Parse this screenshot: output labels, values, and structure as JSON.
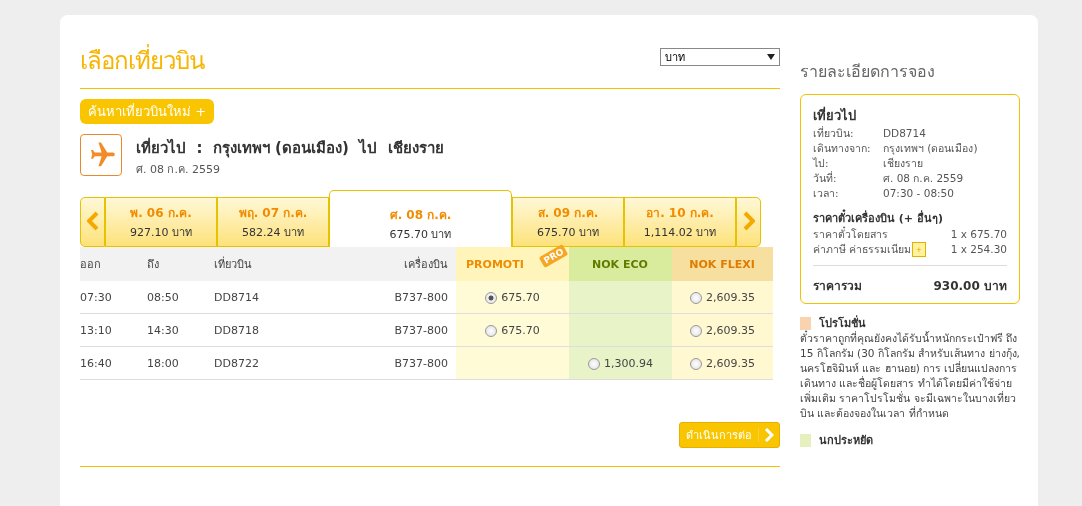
{
  "title": "เลือกเที่ยวบิน",
  "currency": {
    "value": "บาท"
  },
  "new_search": {
    "label": "ค้นหาเที่ยวบินใหม่",
    "icon": "+"
  },
  "route": {
    "title": "เที่ยวไป  :  กรุงเทพฯ (ดอนเมือง)  ไป  เชียงราย",
    "date": "ศ. 08 ก.ค. 2559"
  },
  "date_tabs": [
    {
      "day": "พ. 06 ก.ค.",
      "price": "927.10 บาท",
      "selected": false
    },
    {
      "day": "พฤ. 07 ก.ค.",
      "price": "582.24 บาท",
      "selected": false
    },
    {
      "day": "ศ. 08 ก.ค.",
      "price": "675.70 บาท",
      "selected": true
    },
    {
      "day": "ส. 09 ก.ค.",
      "price": "675.70 บาท",
      "selected": false
    },
    {
      "day": "อา. 10 ก.ค.",
      "price": "1,114.02 บาท",
      "selected": false
    }
  ],
  "table": {
    "columns": [
      "ออก",
      "ถึง",
      "เที่ยวบิน",
      "เครื่องบิน"
    ],
    "fare_columns": [
      {
        "label": "PROMOTI",
        "tag": "PRO",
        "kind": "promo"
      },
      {
        "label": "NOK ECO",
        "kind": "eco"
      },
      {
        "label": "NOK FLEXI",
        "kind": "flexi"
      }
    ],
    "rows": [
      {
        "cells": [
          "07:30",
          "08:50",
          "DD8714",
          "B737-800"
        ],
        "fares": [
          {
            "available": true,
            "price": "675.70",
            "selected": true
          },
          {
            "available": false
          },
          {
            "available": true,
            "price": "2,609.35",
            "selected": false
          }
        ]
      },
      {
        "cells": [
          "13:10",
          "14:30",
          "DD8718",
          "B737-800"
        ],
        "fares": [
          {
            "available": true,
            "price": "675.70",
            "selected": false
          },
          {
            "available": false
          },
          {
            "available": true,
            "price": "2,609.35",
            "selected": false
          }
        ]
      },
      {
        "cells": [
          "16:40",
          "18:00",
          "DD8722",
          "B737-800"
        ],
        "fares": [
          {
            "available": false
          },
          {
            "available": true,
            "price": "1,300.94",
            "selected": false
          },
          {
            "available": true,
            "price": "2,609.35",
            "selected": false
          }
        ]
      }
    ]
  },
  "continue_button": {
    "label": "ดำเนินการต่อ"
  },
  "summary": {
    "title": "รายละเอียดการจอง",
    "section": "เที่ยวไป",
    "details": [
      {
        "label": "เที่ยวบิน:",
        "value": "DD8714"
      },
      {
        "label": "เดินทางจาก:",
        "value": "กรุงเทพฯ (ดอนเมือง)"
      },
      {
        "label": "ไป:",
        "value": "เชียงราย"
      },
      {
        "label": "วันที่:",
        "value": "ศ. 08 ก.ค. 2559"
      },
      {
        "label": "เวลา:",
        "value": "07:30 - 08:50"
      }
    ],
    "price_title": "ราคาตั๋วเครื่องบิน (+ อื่นๆ)",
    "prices": [
      {
        "label": "ราคาตั๋วโดยสาร",
        "value": "1 x 675.70"
      },
      {
        "label": "ค่าภาษี ค่าธรรมเนียม",
        "value": "1 x 254.30",
        "icon": "+"
      }
    ],
    "total_label": "ราคารวม",
    "total": "930.00 บาท"
  },
  "legend": [
    {
      "title": "โปรโมชั่น",
      "color": "#f9d3b0",
      "text": "ตั๋วราคาถูกที่คุณยังคงได้รับน้ำหนักกระเป๋าฟรี ถึง 15 กิโลกรัม (30 กิโลกรัม สำหรับเส้นทาง ย่างกุ้ง, นครโฮจิมินห์ และ ฮานอย) การ เปลี่ยนแปลงการเดินทาง และชื่อผู้โดยสาร ทำได้โดยมีค่าใช้จ่ายเพิ่มเติม ราคาโปรโมชั่น จะมีเฉพาะในบางเที่ยวบิน และต้องจองในเวลา ที่กำหนด"
    },
    {
      "title": "นกประหยัด",
      "color": "#e6f0bf"
    }
  ]
}
